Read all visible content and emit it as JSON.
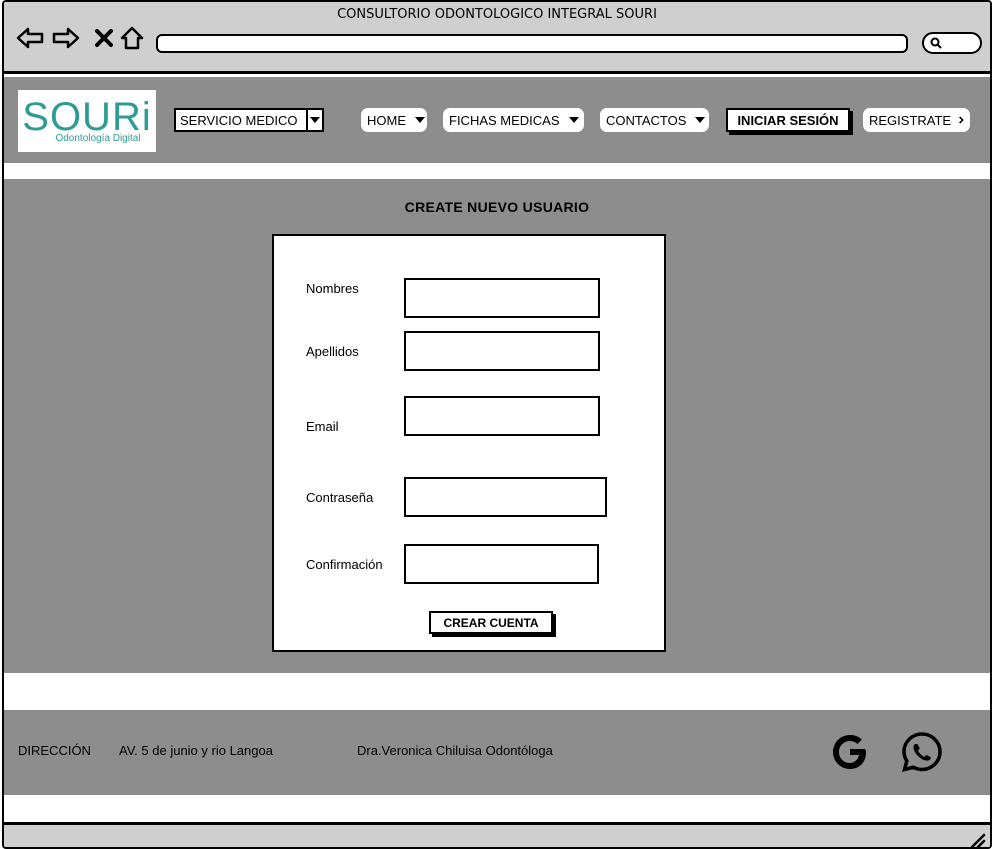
{
  "window": {
    "title": "CONSULTORIO ODONTOLOGICO INTEGRAL SOURI"
  },
  "browser": {
    "back_icon": "back-arrow-icon",
    "forward_icon": "forward-arrow-icon",
    "close_icon": "close-x-icon",
    "home_icon": "home-icon",
    "search_icon": "search-icon",
    "url": ""
  },
  "header": {
    "logo": {
      "main": "SOURi",
      "sub": "Odontología Digital"
    },
    "service_select": {
      "value": "SERVICIO MEDICO"
    },
    "menu": [
      {
        "label": "HOME"
      },
      {
        "label": "FICHAS MEDICAS"
      },
      {
        "label": "CONTACTOS"
      }
    ],
    "login_label": "INICIAR SESIÓN",
    "register_label": "REGISTRATE"
  },
  "form": {
    "title": "CREATE NUEVO USUARIO",
    "fields": [
      {
        "label": "Nombres",
        "value": ""
      },
      {
        "label": "Apellidos",
        "value": ""
      },
      {
        "label": "Email",
        "value": ""
      },
      {
        "label": "Contraseña",
        "value": ""
      },
      {
        "label": "Confirmación",
        "value": ""
      }
    ],
    "submit_label": "CREAR CUENTA"
  },
  "footer": {
    "address_label": "DIRECCIÓN",
    "address": "AV. 5 de junio y rio Langoa",
    "doctor": "Dra.Veronica Chiluisa Odontóloga",
    "icons": [
      "google-icon",
      "whatsapp-icon"
    ]
  },
  "colors": {
    "panel_gray": "#8d8d8d",
    "chrome_gray": "#cfcfcf",
    "brand_teal": "#2e9b95"
  }
}
